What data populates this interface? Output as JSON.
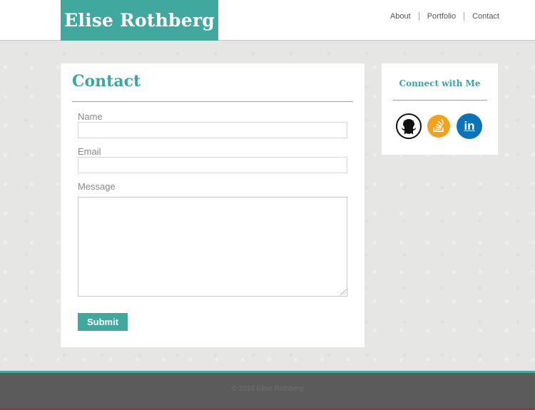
{
  "header": {
    "brand": "Elise Rothberg",
    "nav": [
      "About",
      "Portfolio",
      "Contact"
    ]
  },
  "contact": {
    "title": "Contact",
    "name_label": "Name",
    "name_value": "",
    "email_label": "Email",
    "email_value": "",
    "message_label": "Message",
    "message_value": "",
    "submit_label": "Submit"
  },
  "sidebar": {
    "title": "Connect with Me",
    "icons": [
      "github-icon",
      "stackoverflow-icon",
      "linkedin-icon"
    ],
    "linkedin_text": "in"
  },
  "footer": {
    "copyright": "© 2016 Elise Rothberg"
  },
  "colors": {
    "accent": "#41a8a0",
    "footer": "#5b5b5b",
    "stackoverflow": "#f4a21b",
    "linkedin": "#0a74b8"
  }
}
